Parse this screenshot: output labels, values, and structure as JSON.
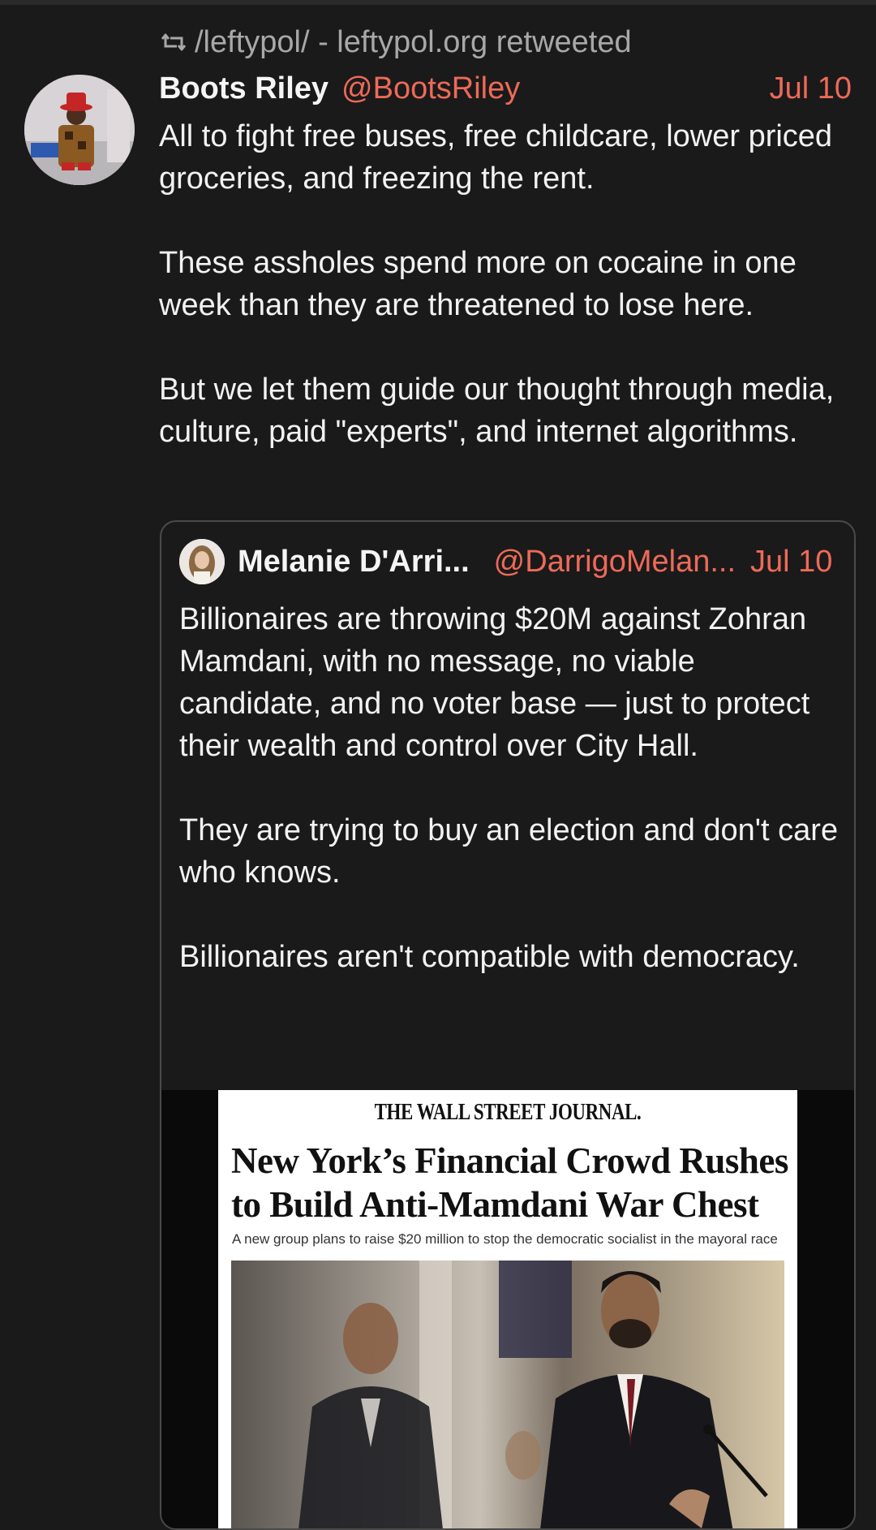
{
  "retweet": {
    "text": "/leftypol/ - leftypol.org retweeted",
    "icon": "retweet-icon"
  },
  "tweet": {
    "author_name": "Boots Riley",
    "author_handle": "@BootsRiley",
    "date": "Jul 10",
    "paragraphs": [
      "All to fight free buses, free childcare, lower priced groceries, and freezing the rent.",
      "These assholes spend more on cocaine in one week than they are threatened to lose here.",
      "But we let them guide our thought through media, culture, paid \"experts\", and internet algorithms."
    ]
  },
  "quote": {
    "author_name": "Melanie D'Arri...",
    "author_handle": "@DarrigoMelan...",
    "date": "Jul 10",
    "paragraphs": [
      "Billionaires are throwing $20M against Zohran Mamdani, with no message, no viable candidate, and no voter base — just to protect their wealth and control over City Hall.",
      "They are trying to buy an election and don't care who knows.",
      "Billionaires aren't compatible with democracy."
    ]
  },
  "media": {
    "masthead": "THE WALL STREET JOURNAL.",
    "headline": "New York’s Financial Crowd Rushes to Build Anti-Mamdani War Chest",
    "subhead": "A new group plans to raise $20 million to stop the democratic socialist in the mayoral race"
  },
  "colors": {
    "background": "#1a1a1a",
    "text": "#f2f2f2",
    "muted": "#a8a8a8",
    "accent": "#ee6a58",
    "border": "#4a4a4a"
  }
}
